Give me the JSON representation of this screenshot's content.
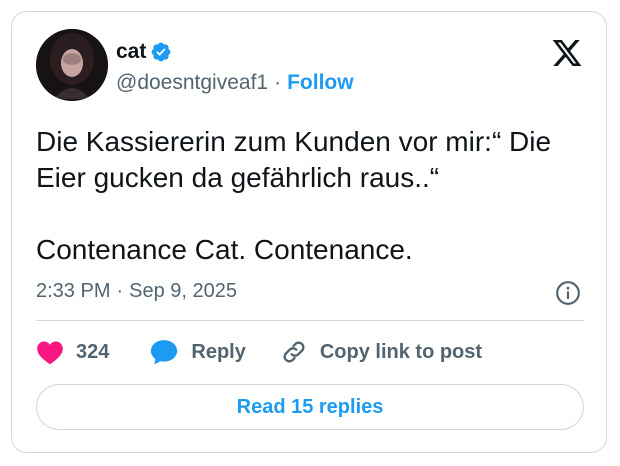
{
  "user": {
    "name": "cat",
    "handle": "@doesntgiveaf1",
    "follow_label": "Follow",
    "separator": "·"
  },
  "tweet": {
    "text": "Die Kassiererin zum Kunden vor mir:“ Die\nEier gucken da gefährlich raus..“\n\nContenance Cat. Contenance.",
    "time": "2:33 PM",
    "date": "Sep 9, 2025",
    "meta_separator": "·"
  },
  "actions": {
    "likes_count": "324",
    "reply_label": "Reply",
    "copy_label": "Copy link to post"
  },
  "read_replies_label": "Read 15 replies",
  "colors": {
    "accent": "#1d9bf0",
    "like": "#f91880",
    "text": "#0f1419",
    "muted": "#536471",
    "border": "#cfd9de"
  },
  "icons": {
    "logo": "x-logo-icon",
    "verified": "verified-badge-icon",
    "info": "info-icon",
    "like": "heart-icon",
    "reply": "speech-bubble-icon",
    "copy": "link-icon"
  }
}
